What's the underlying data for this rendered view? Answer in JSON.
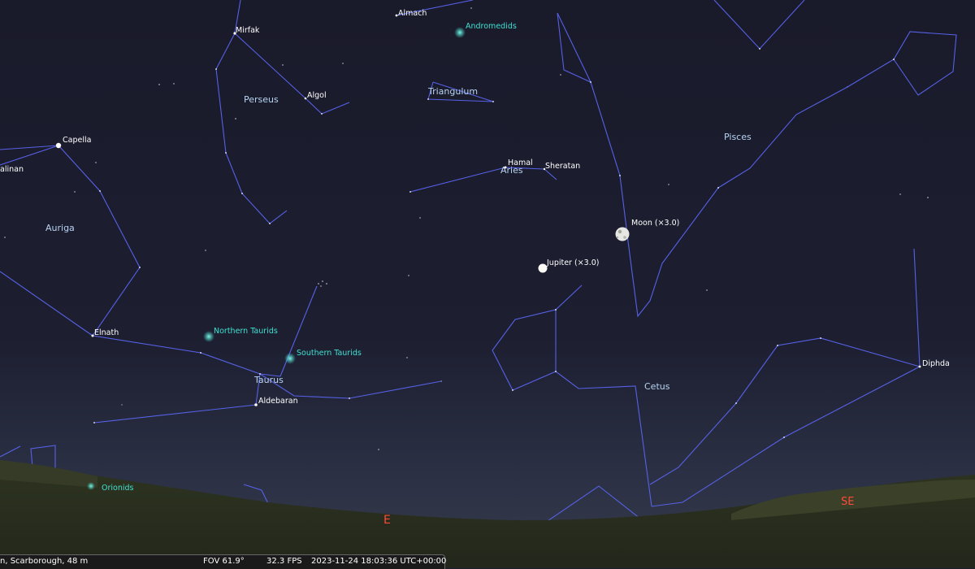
{
  "colors": {
    "constellation_line": "#5661e6",
    "star_label": "#ffffff",
    "constellation_name": "#b8d4f2",
    "meteor_shower": "#3fe0d0",
    "cardinal": "#ff4a3a"
  },
  "constellations": {
    "perseus": "Perseus",
    "triangulum": "Triangulum",
    "aries": "Aries",
    "pisces": "Pisces",
    "auriga": "Auriga",
    "taurus": "Taurus",
    "cetus": "Cetus"
  },
  "stars": {
    "almach": "Almach",
    "mirfak": "Mirfak",
    "algol": "Algol",
    "capella": "Capella",
    "menkalinan": "alinan",
    "hamal": "Hamal",
    "sheratan": "Sheratan",
    "elnath": "Elnath",
    "aldebaran": "Aldebaran",
    "diphda": "Diphda"
  },
  "planets": {
    "moon": "Moon (×3.0)",
    "jupiter": "Jupiter (×3.0)"
  },
  "meteor_showers": {
    "andromedids": "Andromedids",
    "northern_taurids": "Northern Taurids",
    "southern_taurids": "Southern Taurids",
    "orionids": "Orionids"
  },
  "cardinals": {
    "east": "E",
    "southeast": "SE"
  },
  "status": {
    "location": "n, Scarborough, 48 m",
    "fov": "FOV 61.9°",
    "fps": "32.3 FPS",
    "datetime": "2023-11-24 18:03:36 UTC+00:00"
  }
}
